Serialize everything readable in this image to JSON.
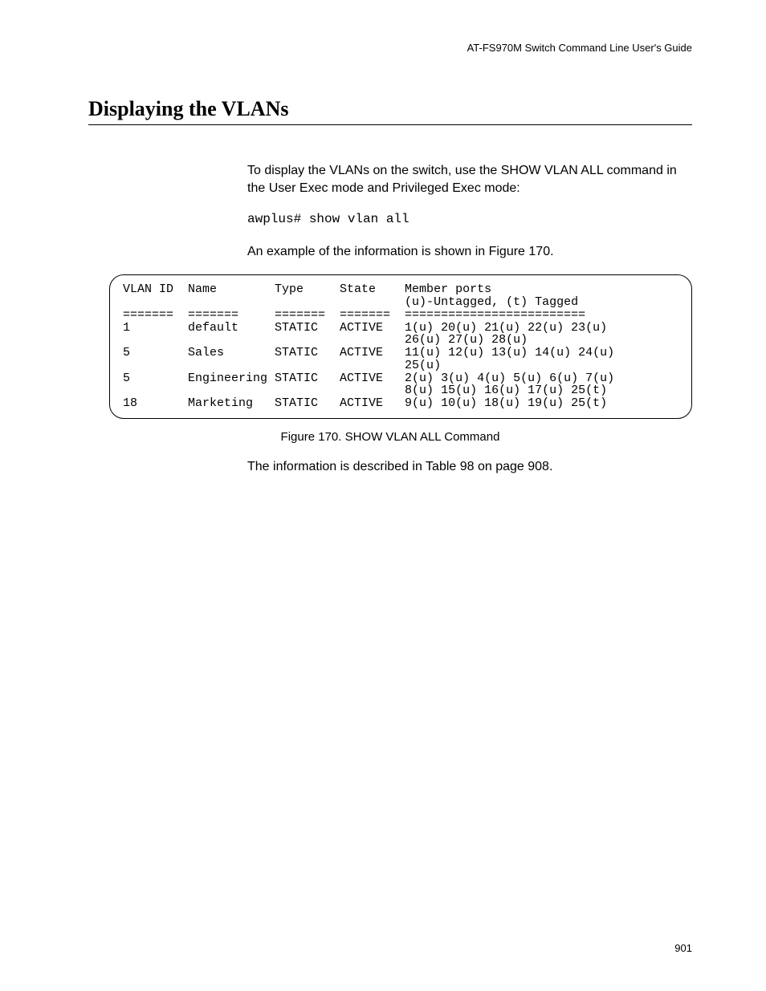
{
  "running_head": "AT-FS970M Switch Command Line User's Guide",
  "section_title": "Displaying the VLANs",
  "intro_para": "To display the VLANs on the switch, use the SHOW VLAN ALL command in the User Exec mode and Privileged Exec mode:",
  "command_line": "awplus# show vlan all",
  "example_para": "An example of the information is shown in Figure 170.",
  "vlan_output": {
    "header_cols": [
      "VLAN ID",
      "Name",
      "Type",
      "State",
      "Member ports"
    ],
    "header_sub": "(u)-Untagged, (t) Tagged",
    "separator": "=======  =======     =======  =======  =========================",
    "rows": [
      {
        "id": "1",
        "name": "default",
        "type": "STATIC",
        "state": "ACTIVE",
        "ports": "1(u) 20(u) 21(u) 22(u) 23(u)\n26(u) 27(u) 28(u)"
      },
      {
        "id": "5",
        "name": "Sales",
        "type": "STATIC",
        "state": "ACTIVE",
        "ports": "11(u) 12(u) 13(u) 14(u) 24(u)\n25(u)"
      },
      {
        "id": "5",
        "name": "Engineering",
        "type": "STATIC",
        "state": "ACTIVE",
        "ports": "2(u) 3(u) 4(u) 5(u) 6(u) 7(u)\n8(u) 15(u) 16(u) 17(u) 25(t)"
      },
      {
        "id": "18",
        "name": "Marketing",
        "type": "STATIC",
        "state": "ACTIVE",
        "ports": "9(u) 10(u) 18(u) 19(u) 25(t)"
      }
    ]
  },
  "figure_caption": "Figure 170. SHOW VLAN ALL Command",
  "closing_para": "The information is described in Table 98 on page 908.",
  "page_number": "901"
}
